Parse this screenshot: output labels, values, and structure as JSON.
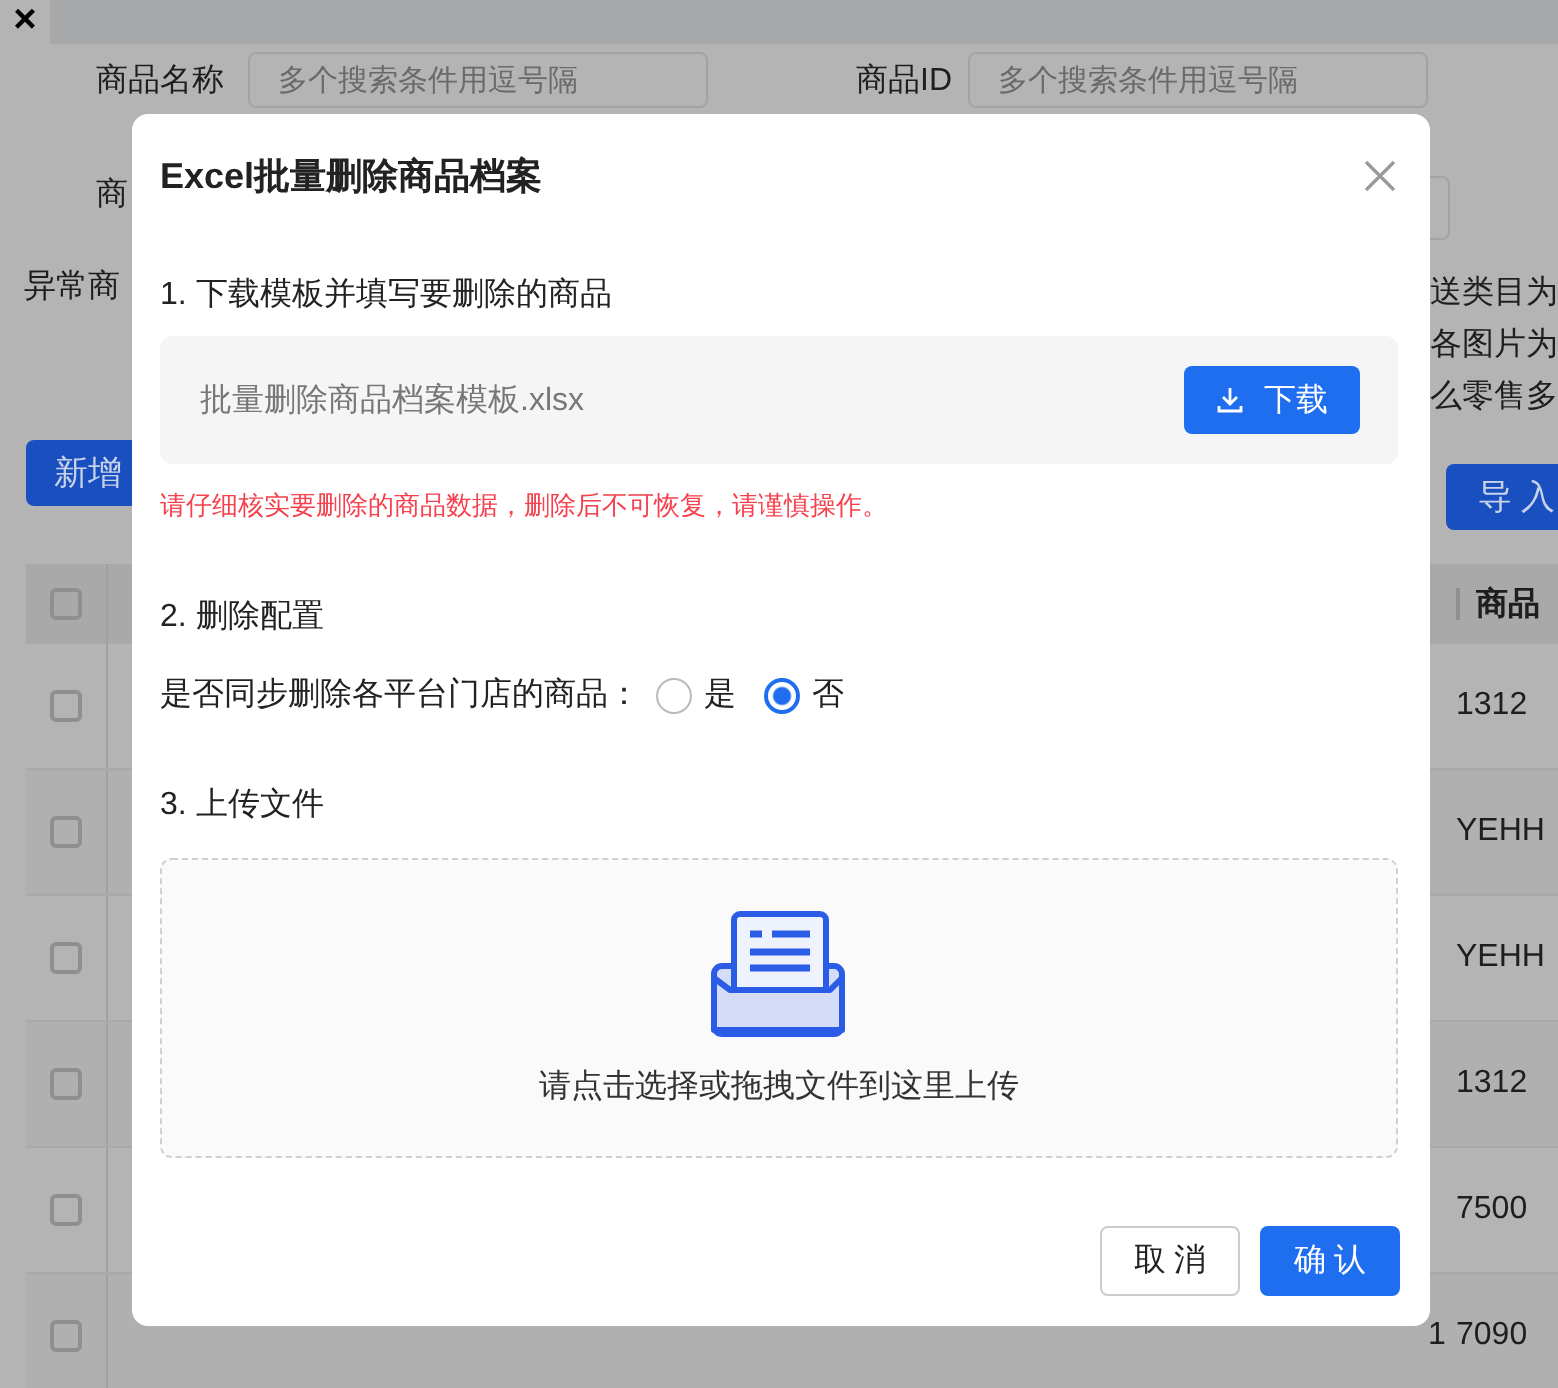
{
  "background": {
    "close": "×",
    "filters": [
      {
        "label": "商品名称",
        "placeholder": "多个搜索条件用逗号隔"
      },
      {
        "label": "商品ID",
        "placeholder": "多个搜索条件用逗号隔"
      }
    ],
    "filter_row_2_label": "商",
    "notice_left": "异常商",
    "notice_right": [
      "送类目为",
      "各图片为",
      "么零售多"
    ],
    "buttons": [
      "新增",
      "导 入"
    ],
    "table": {
      "header_checked": false,
      "header": "商品",
      "rows": [
        {
          "checked": false,
          "value": "1312"
        },
        {
          "checked": false,
          "value": "YEHH"
        },
        {
          "checked": false,
          "value": "YEHH"
        },
        {
          "checked": false,
          "value": "1312"
        },
        {
          "checked": false,
          "value": "7500"
        },
        {
          "checked": false,
          "column_3": "1",
          "value": "7090"
        }
      ]
    }
  },
  "dialog": {
    "title": "Excel批量删除商品档案",
    "step_1": {
      "heading": "1. 下载模板并填写要删除的商品",
      "file_name": "批量删除商品档案模板.xlsx",
      "download_button": "下载",
      "warning": "请仔细核实要删除的商品数据，删除后不可恢复，请谨慎操作。"
    },
    "step_2": {
      "heading": "2. 删除配置",
      "question": "是否同步删除各平台门店的商品：",
      "options": [
        {
          "label": "是",
          "selected": false
        },
        {
          "label": "否",
          "selected": true
        }
      ]
    },
    "step_3": {
      "heading": "3. 上传文件",
      "drop_hint": "请点击选择或拖拽文件到这里上传"
    },
    "buttons": {
      "cancel": "取 消",
      "confirm": "确 认"
    }
  }
}
